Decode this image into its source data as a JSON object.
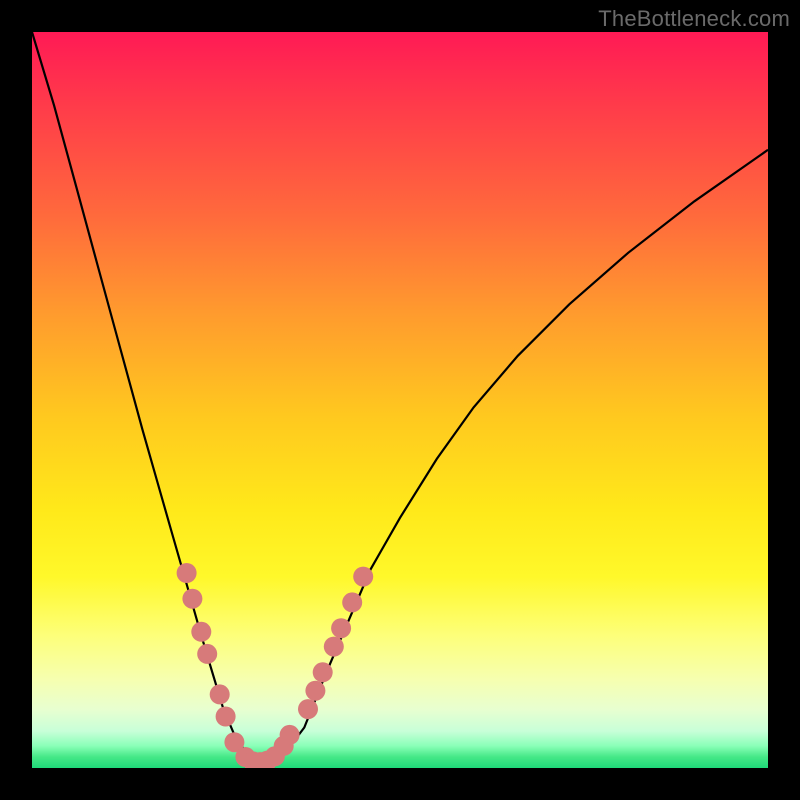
{
  "watermark": "TheBottleneck.com",
  "chart_data": {
    "type": "line",
    "title": "",
    "xlabel": "",
    "ylabel": "",
    "xlim": [
      0,
      100
    ],
    "ylim": [
      0,
      100
    ],
    "grid": false,
    "series": [
      {
        "name": "curve",
        "x": [
          0,
          3,
          6,
          9,
          12,
          15,
          17,
          19,
          21,
          23,
          24.5,
          26,
          27.5,
          29,
          30,
          31,
          32.5,
          34.5,
          37,
          40,
          43,
          46,
          50,
          55,
          60,
          66,
          73,
          81,
          90,
          100
        ],
        "y": [
          100,
          90,
          79,
          68,
          57,
          46,
          39,
          32,
          25,
          18,
          13,
          8,
          4.5,
          2.2,
          1.2,
          0.8,
          1.0,
          2.2,
          5.5,
          13,
          20,
          27,
          34,
          42,
          49,
          56,
          63,
          70,
          77,
          84
        ]
      }
    ],
    "markers": {
      "name": "highlight-dots",
      "color": "#d77a7a",
      "points": [
        {
          "x": 21.0,
          "y": 26.5
        },
        {
          "x": 21.8,
          "y": 23.0
        },
        {
          "x": 23.0,
          "y": 18.5
        },
        {
          "x": 23.8,
          "y": 15.5
        },
        {
          "x": 25.5,
          "y": 10.0
        },
        {
          "x": 26.3,
          "y": 7.0
        },
        {
          "x": 27.5,
          "y": 3.5
        },
        {
          "x": 29.0,
          "y": 1.5
        },
        {
          "x": 30.0,
          "y": 0.9
        },
        {
          "x": 31.0,
          "y": 0.8
        },
        {
          "x": 32.0,
          "y": 1.0
        },
        {
          "x": 33.0,
          "y": 1.6
        },
        {
          "x": 34.2,
          "y": 3.0
        },
        {
          "x": 35.0,
          "y": 4.5
        },
        {
          "x": 37.5,
          "y": 8.0
        },
        {
          "x": 38.5,
          "y": 10.5
        },
        {
          "x": 39.5,
          "y": 13.0
        },
        {
          "x": 41.0,
          "y": 16.5
        },
        {
          "x": 42.0,
          "y": 19.0
        },
        {
          "x": 43.5,
          "y": 22.5
        },
        {
          "x": 45.0,
          "y": 26.0
        }
      ]
    },
    "background_gradient": {
      "top_color": "#ff1a55",
      "mid_color": "#ffe91a",
      "bottom_color": "#1fd979"
    }
  }
}
